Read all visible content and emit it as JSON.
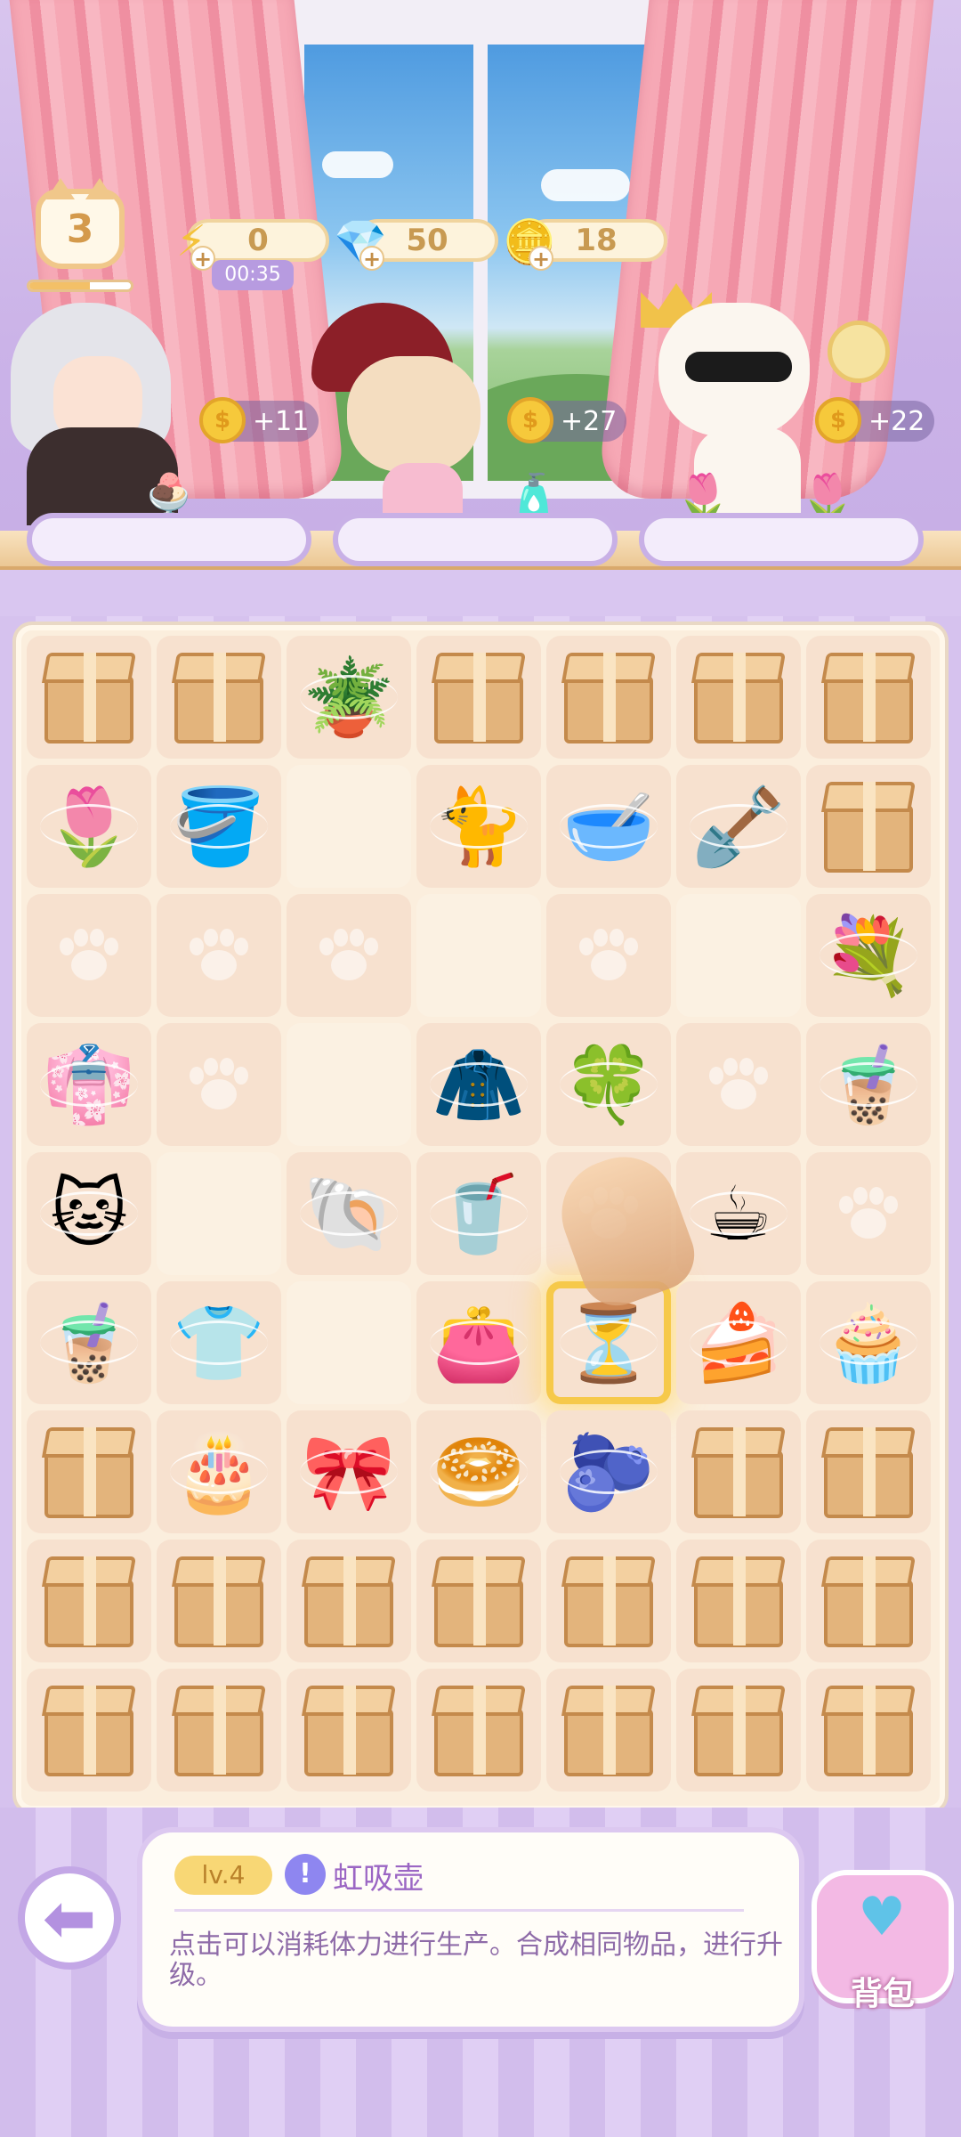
{
  "hud": {
    "level": "3",
    "energy": "0",
    "energy_timer": "00:35",
    "gems": "50",
    "coins": "18"
  },
  "customers": [
    {
      "name": "grandma",
      "reward": "",
      "order_icon": "🍨"
    },
    {
      "name": "witch-cat",
      "reward": "+11",
      "order_icon": "🌷"
    },
    {
      "name": "king-cat",
      "reward": "+27",
      "order_icon": "🧴"
    },
    {
      "extra_reward": "+22",
      "order_icon": "🌷"
    }
  ],
  "board": {
    "rows": [
      [
        "box",
        "box",
        "watering-can",
        "box",
        "box",
        "box",
        "box"
      ],
      [
        "tulip",
        "pot",
        "blank",
        "cat",
        "bowl",
        "shovel",
        "box"
      ],
      [
        "paw",
        "paw",
        "paw",
        "blank",
        "paw",
        "blank",
        "flowers"
      ],
      [
        "dress",
        "paw",
        "blank",
        "coat",
        "flower",
        "paw",
        "drink"
      ],
      [
        "cat-head",
        "blank",
        "pearl",
        "cola",
        "paw",
        "coffee",
        "paw"
      ],
      [
        "drink",
        "sweater",
        "blank",
        "pouch",
        "hourglass",
        "cake-blank",
        "cake"
      ],
      [
        "box",
        "cake2",
        "ribbon",
        "bun",
        "plum",
        "box",
        "box"
      ],
      [
        "box",
        "box",
        "box",
        "box",
        "box",
        "box",
        "box"
      ],
      [
        "box",
        "box",
        "box",
        "box",
        "box",
        "box",
        "box"
      ]
    ],
    "icons": {
      "watering-can": "🪴",
      "tulip": "🌷",
      "pot": "🪣",
      "cat": "🐈",
      "bowl": "🥣",
      "shovel": "🪏",
      "flowers": "💐",
      "dress": "👘",
      "coat": "🧥",
      "flower": "🍀",
      "drink": "🧋",
      "cat-head": "🐱",
      "pearl": "🐚",
      "cola": "🥤",
      "coffee": "☕",
      "sweater": "👕",
      "pouch": "👛",
      "hourglass": "⏳",
      "cake-blank": "🍰",
      "cake": "🧁",
      "cake2": "🎂",
      "ribbon": "🎀",
      "bun": "🥯",
      "plum": "🫐"
    },
    "selected": [
      5,
      4
    ]
  },
  "info_panel": {
    "level_tag": "lv.4",
    "info_icon": "!",
    "item_name": "虹吸壶",
    "description": "点击可以消耗体力进行生产。合成相同物品，进行升级。"
  },
  "bag": {
    "label": "背包"
  },
  "icons": {
    "back": "arrow-left-icon",
    "energy": "lightning-icon",
    "gem": "gem-icon",
    "coin": "coin-icon"
  },
  "colors": {
    "accent": "#c3a7e6",
    "gold": "#f6c93b"
  }
}
